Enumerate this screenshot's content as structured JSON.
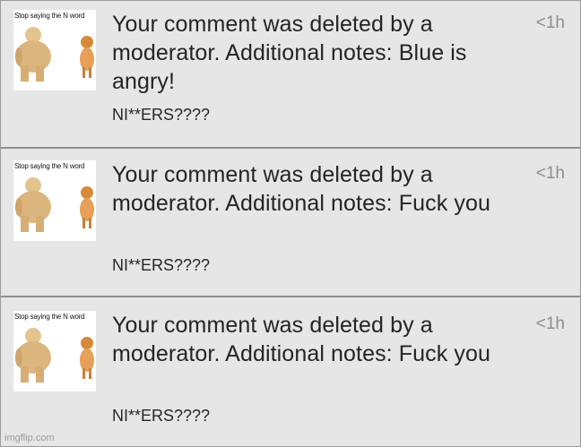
{
  "notifications": [
    {
      "thumbnail_text": "Stop saying the N word",
      "message": "Your comment was deleted by a moderator. Additional notes: Blue is angry!",
      "subtext": "NI**ERS????",
      "time": "<1h"
    },
    {
      "thumbnail_text": "Stop saying the N word",
      "message": "Your comment was deleted by a moderator. Additional notes: Fuck you",
      "subtext": "NI**ERS????",
      "time": "<1h"
    },
    {
      "thumbnail_text": "Stop saying the N word",
      "message": "Your comment was deleted by a moderator. Additional notes: Fuck you",
      "subtext": "NI**ERS????",
      "time": "<1h"
    }
  ],
  "watermark": "imgflip.com",
  "colors": {
    "background": "#e6e6e6",
    "divider": "#8f8f8f",
    "text": "#242424",
    "time": "#8e8e8e"
  }
}
